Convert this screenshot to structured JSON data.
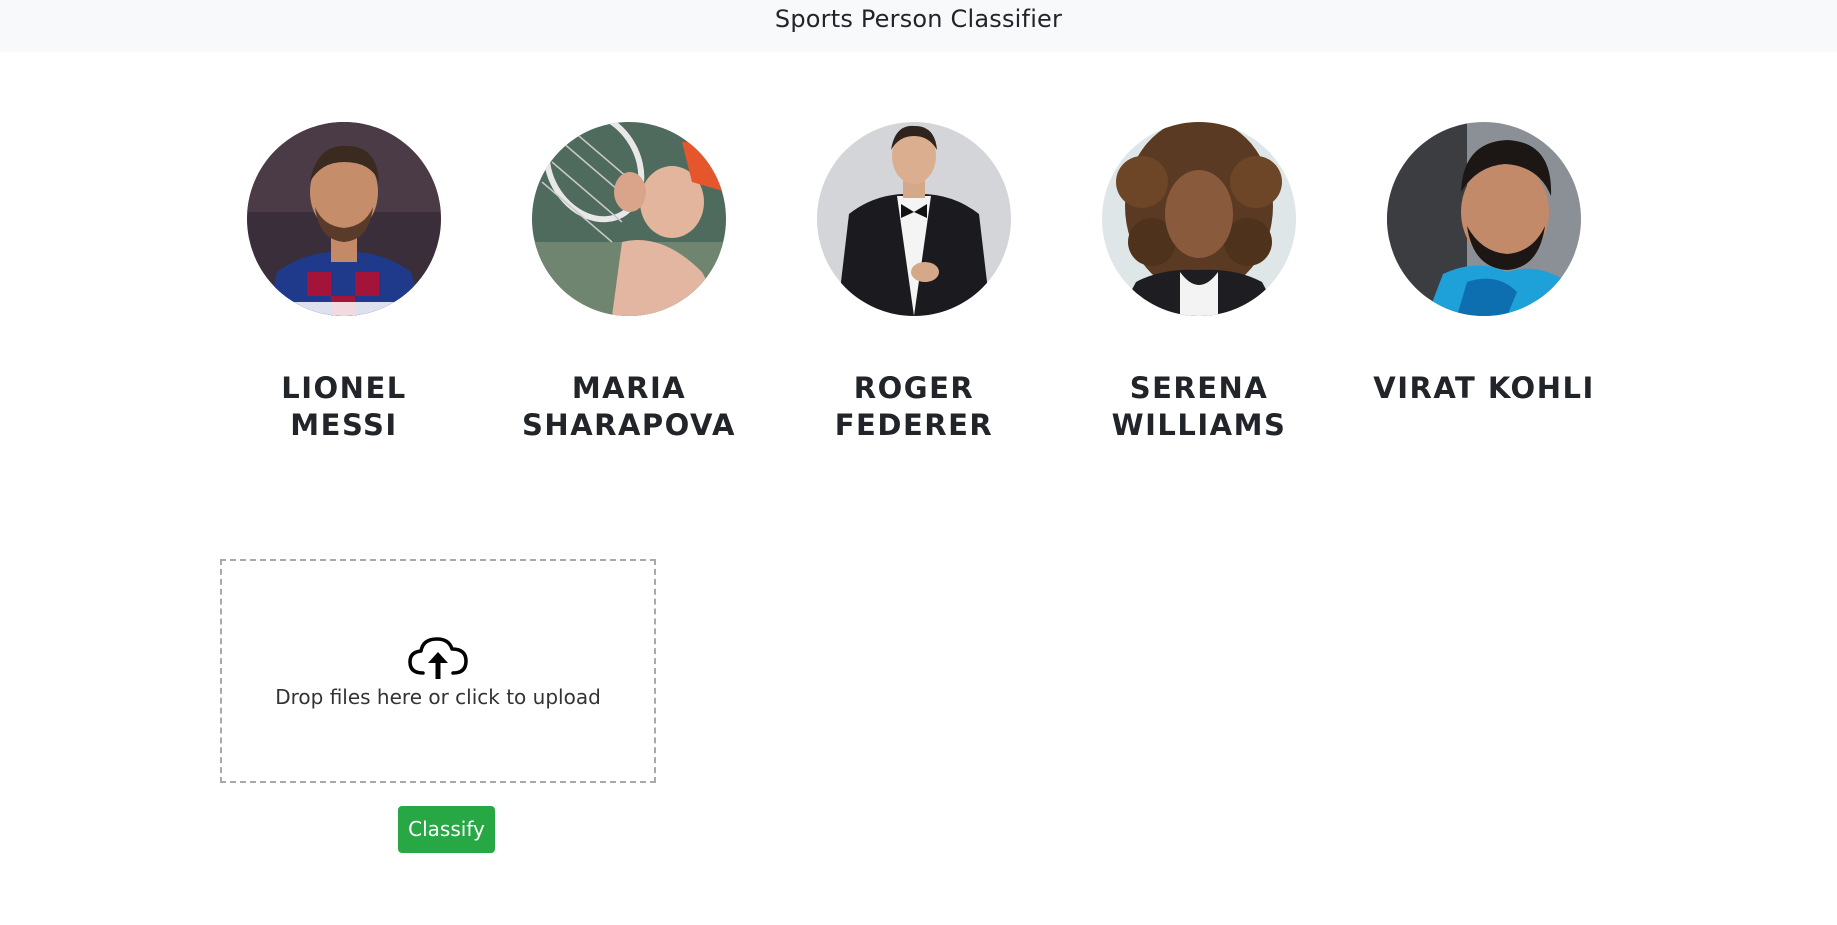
{
  "header": {
    "title": "Sports Person Classifier"
  },
  "players": [
    {
      "name": "LIONEL MESSI",
      "photo": "lionel-messi-photo"
    },
    {
      "name": "MARIA SHARAPOVA",
      "photo": "maria-sharapova-photo"
    },
    {
      "name": "ROGER FEDERER",
      "photo": "roger-federer-photo"
    },
    {
      "name": "SERENA WILLIAMS",
      "photo": "serena-williams-photo"
    },
    {
      "name": "VIRAT KOHLI",
      "photo": "virat-kohli-photo"
    }
  ],
  "upload": {
    "icon": "cloud-upload-icon",
    "message": "Drop files here or click to upload"
  },
  "classify_button": {
    "label": "Classify",
    "color": "#28a745"
  },
  "colors": {
    "navbar_bg": "#f8f9fa",
    "text": "#212529",
    "dropzone_border": "#a9a9a9"
  }
}
